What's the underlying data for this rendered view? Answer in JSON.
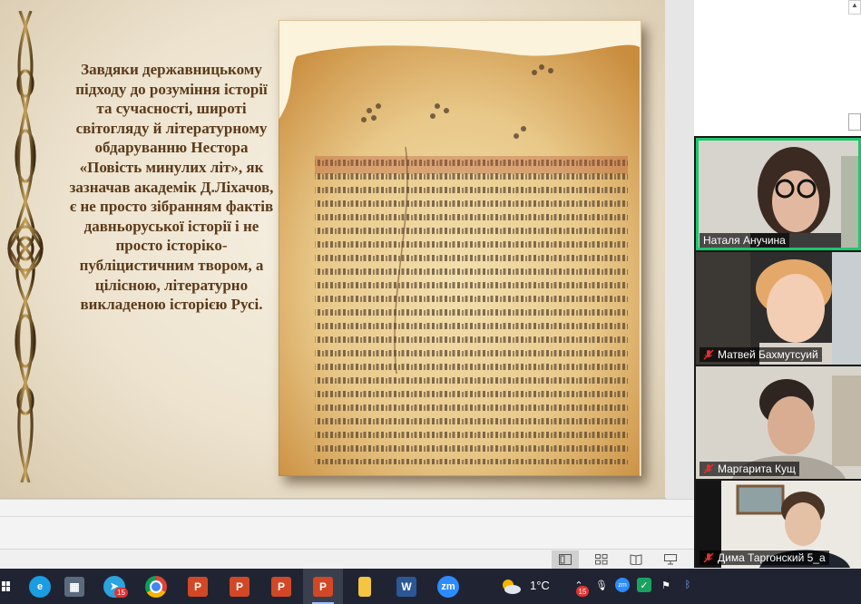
{
  "slide": {
    "text": "Завдяки державницькому підходу до розуміння історії та сучасності, широті світогляду й літературному обдаруванню Нестора «Повість минулих літ», як зазначав академік Д.Ліхачов, є не просто зібранням фактів давньоруської історії і не просто історіко-публіцистичним твором, а цілісною, літературно викладеною історією Русі."
  },
  "participants": [
    {
      "name": "Наталя Анучина",
      "muted": false,
      "speaking": true
    },
    {
      "name": "Матвей Бахмутсуий",
      "muted": true,
      "speaking": false
    },
    {
      "name": "Маргарита Кущ",
      "muted": true,
      "speaking": false
    },
    {
      "name": "Дима Таргонский 5_а",
      "muted": true,
      "speaking": false
    }
  ],
  "status_bar": {
    "views": [
      "normal-view-icon",
      "slide-sorter-icon",
      "reading-view-icon",
      "slideshow-icon"
    ]
  },
  "taskbar": {
    "apps": [
      {
        "icon": "edge-icon",
        "color": "#1b9de2"
      },
      {
        "icon": "calculator-icon",
        "color": "#5a6b7d"
      },
      {
        "icon": "telegram-icon",
        "color": "#2aa3df",
        "badge": "15"
      },
      {
        "icon": "chrome-icon",
        "color": "#dd4b39"
      },
      {
        "icon": "powerpoint-icon",
        "color": "#d24726",
        "label": "P"
      },
      {
        "icon": "powerpoint-icon",
        "color": "#d24726",
        "label": "P"
      },
      {
        "icon": "powerpoint-icon",
        "color": "#d24726",
        "label": "P"
      },
      {
        "icon": "powerpoint-icon",
        "color": "#d24726",
        "label": "P",
        "active": true
      },
      {
        "icon": "file-explorer-icon",
        "color": "#f4c542"
      },
      {
        "icon": "word-icon",
        "color": "#2b5797",
        "label": "W"
      },
      {
        "icon": "zoom-icon",
        "color": "#2d8cff",
        "label": "zm"
      }
    ],
    "weather": {
      "temp": "1°C"
    },
    "tray_badge": "15"
  }
}
